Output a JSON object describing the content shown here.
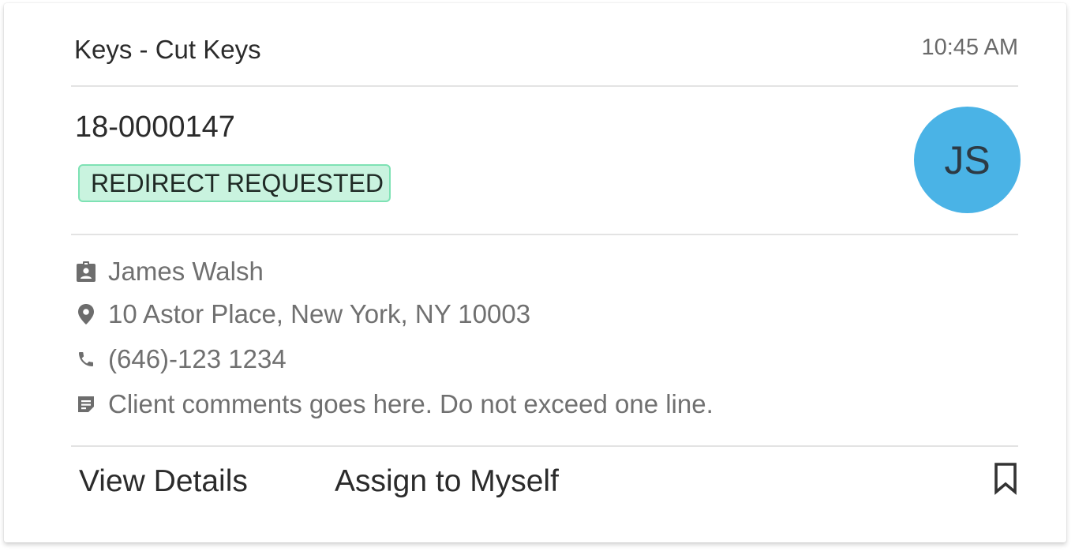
{
  "card": {
    "category": "Keys - Cut Keys",
    "time": "10:45 AM",
    "order_id": "18-0000147",
    "status_badge": "REDIRECT REQUESTED",
    "avatar_initials": "JS",
    "client_name": "James Walsh",
    "address": "10 Astor Place, New York, NY 10003",
    "phone": "(646)-123 1234",
    "comment": "Client comments goes here. Do not exceed one line.",
    "actions": {
      "view_details": "View Details",
      "assign": "Assign to Myself"
    }
  },
  "icons": {
    "client": "badge-icon",
    "address": "location-pin-icon",
    "phone": "phone-icon",
    "comment": "note-icon",
    "bookmark": "bookmark-icon"
  },
  "colors": {
    "badge_bg": "#c9f3df",
    "badge_border": "#7ee2b4",
    "avatar_bg": "#4ab3e6",
    "icon": "#6d6d6d"
  }
}
